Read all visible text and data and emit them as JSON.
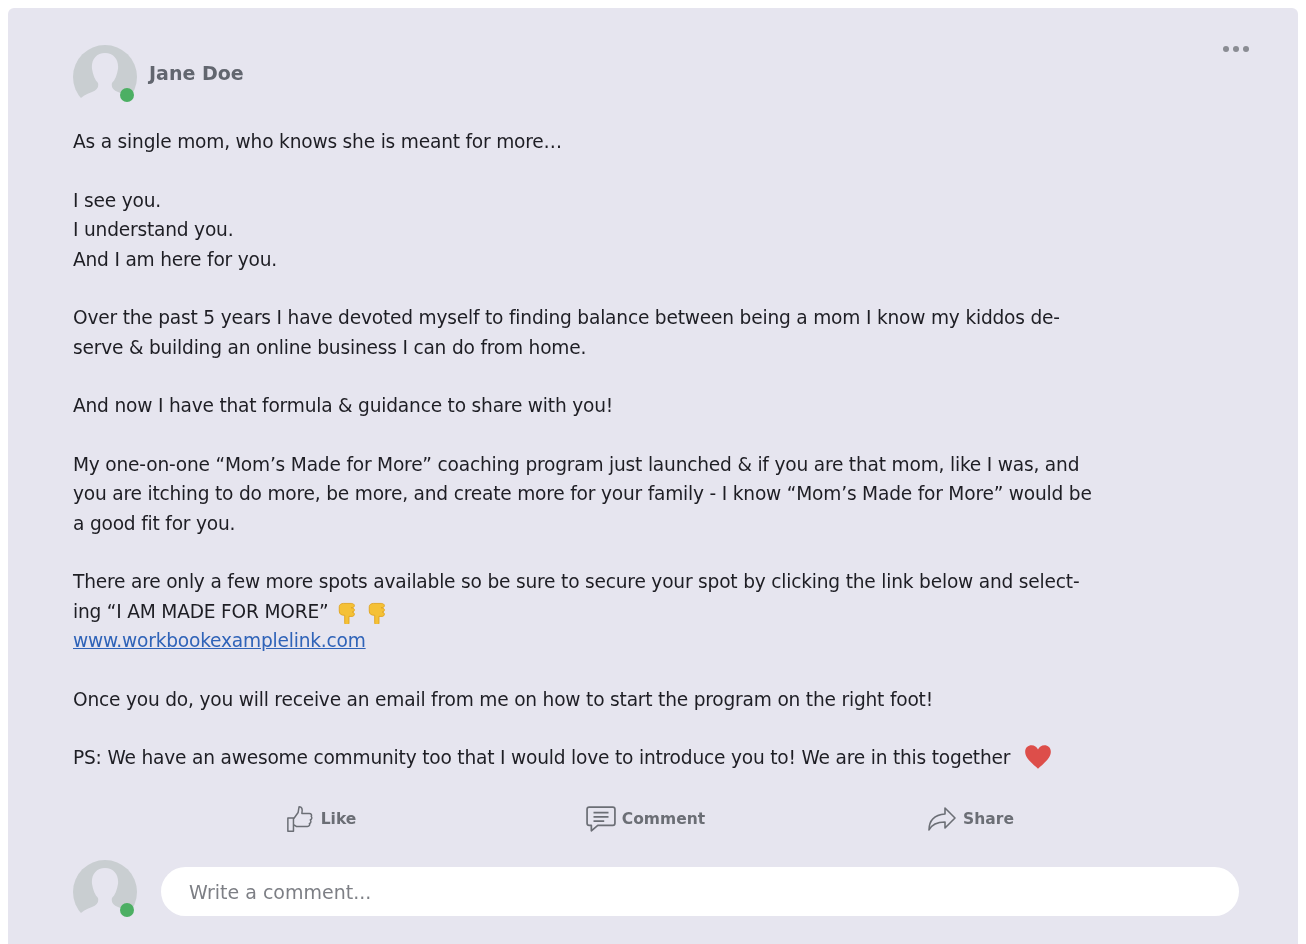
{
  "post": {
    "author": {
      "name": "Jane Doe",
      "online": true
    },
    "paragraphs": [
      {
        "lines": [
          "As a single mom, who knows she is meant for more…"
        ]
      },
      {
        "lines": [
          "I see you.",
          "I understand you.",
          "And I am here for you."
        ]
      },
      {
        "lines": [
          "Over the past 5 years I have devoted myself to finding balance between being a mom I know my kiddos de-",
          "serve & building an online business I can do from home."
        ]
      },
      {
        "lines": [
          "And now I have that formula & guidance to share with you!"
        ]
      },
      {
        "lines": [
          "My one-on-one “Mom’s Made for More” coaching program just launched & if you are that mom, like I was, and",
          "you are itching to do more, be more, and create more for your family - I know “Mom’s Made for More” would be",
          "a good fit for you."
        ]
      },
      {
        "lines": [
          "There are only a few more spots available so be sure to secure your spot by clicking the link below and select-",
          "ing “I AM MADE FOR MORE”"
        ],
        "link": "www.workbookexamplelink.com"
      },
      {
        "lines": [
          "Once you do, you will receive an email from me on how to start the program on the right foot!"
        ]
      },
      {
        "lines": [
          "PS: We have an awesome community too that I would love to introduce you to! We are in this together"
        ]
      }
    ]
  },
  "actions": [
    {
      "kind": "like",
      "label": "Like"
    },
    {
      "kind": "comment",
      "label": "Comment"
    },
    {
      "kind": "share",
      "label": "Share"
    }
  ],
  "comment_box": {
    "placeholder": "Write a comment...",
    "user_online": true
  }
}
